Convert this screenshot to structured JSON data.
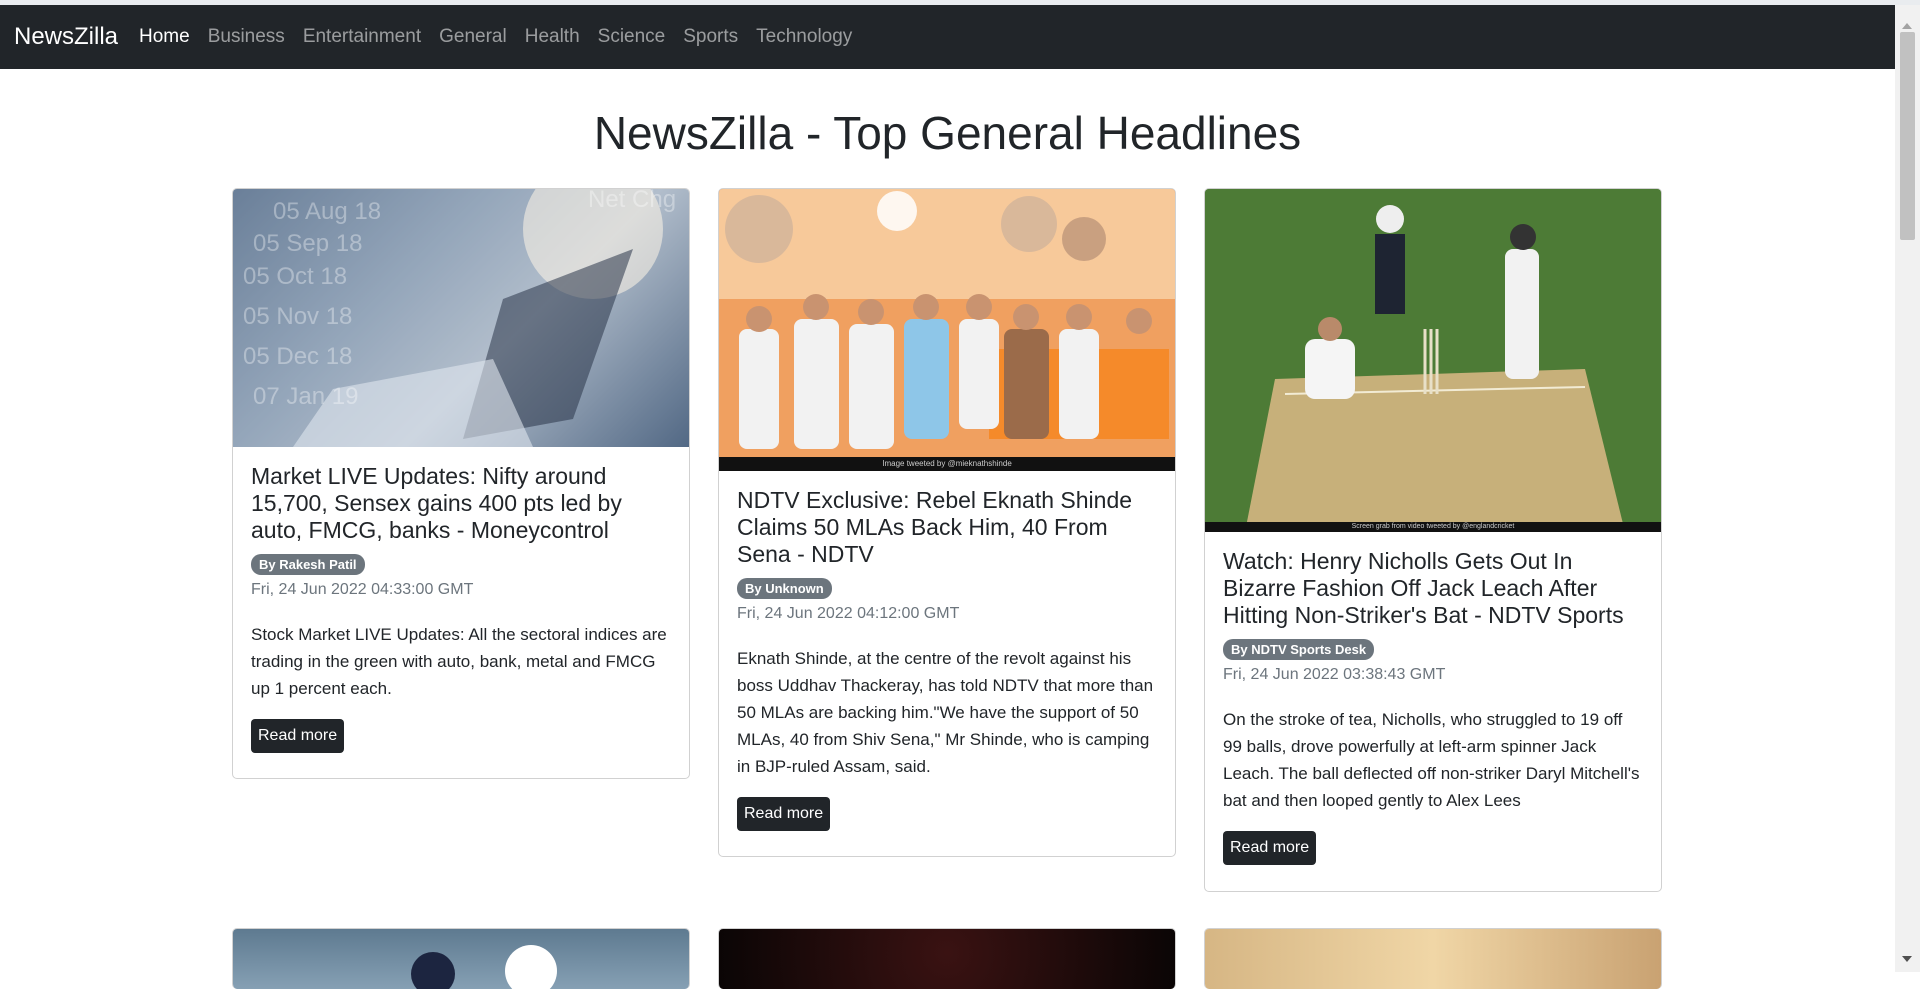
{
  "nav": {
    "brand": "NewsZilla",
    "links": [
      "Home",
      "Business",
      "Entertainment",
      "General",
      "Health",
      "Science",
      "Sports",
      "Technology"
    ],
    "active": "Home"
  },
  "page_title": "NewsZilla - Top General Headlines",
  "colors": {
    "navbar_bg": "#212529",
    "badge_bg": "#6c757d",
    "button_bg": "#212529"
  },
  "articles": [
    {
      "title": "Market LIVE Updates: Nifty around 15,700, Sensex gains 400 pts led by auto, FMCG, banks - Moneycontrol",
      "author": "By Rakesh Patil",
      "date": "Fri, 24 Jun 2022 04:33:00 GMT",
      "description": "Stock Market LIVE Updates: All the sectoral indices are trading in the green with auto, bank, metal and FMCG up 1 percent each.",
      "button": "Read more",
      "image_overlay": [
        "05 Aug 18",
        "05 Sep 18",
        "05 Oct 18",
        "05 Nov 18",
        "05 Dec 18",
        "07 Jan 19",
        "Net Chg"
      ]
    },
    {
      "title": "NDTV Exclusive: Rebel Eknath Shinde Claims 50 MLAs Back Him, 40 From Sena - NDTV",
      "author": "By Unknown",
      "date": "Fri, 24 Jun 2022 04:12:00 GMT",
      "description": "Eknath Shinde, at the centre of the revolt against his boss Uddhav Thackeray, has told NDTV that more than 50 MLAs are backing him.\"We have the support of 50 MLAs, 40 from Shiv Sena,\" Mr Shinde, who is camping in BJP-ruled Assam, said.",
      "button": "Read more",
      "image_caption": "Image tweeted by @mieknathshinde"
    },
    {
      "title": "Watch: Henry Nicholls Gets Out In Bizarre Fashion Off Jack Leach After Hitting Non-Striker's Bat - NDTV Sports",
      "author": "By NDTV Sports Desk",
      "date": "Fri, 24 Jun 2022 03:38:43 GMT",
      "description": "On the stroke of tea, Nicholls, who struggled to 19 off 99 balls, drove powerfully at left-arm spinner Jack Leach. The ball deflected off non-striker Daryl Mitchell's bat and then looped gently to Alex Lees",
      "button": "Read more",
      "image_caption": "Screen grab from video tweeted by @englandcricket"
    }
  ]
}
